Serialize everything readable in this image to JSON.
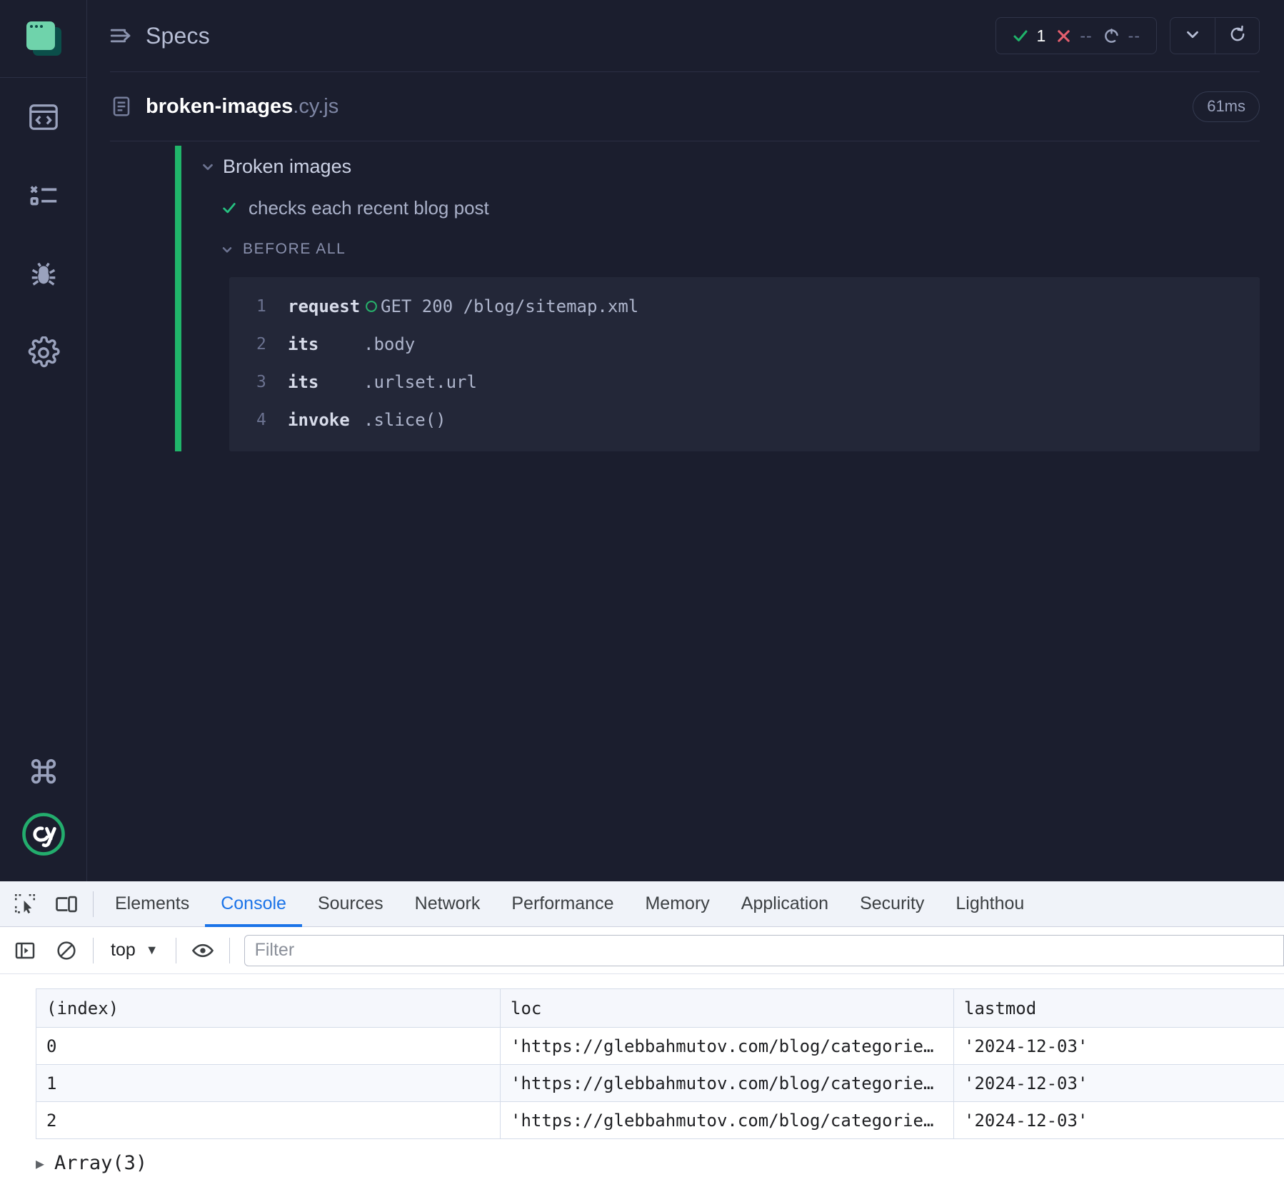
{
  "app": {
    "logo_icon": "cypress-specs-logo",
    "rail_items": [
      {
        "name": "specs",
        "icon": "browser-code-icon"
      },
      {
        "name": "runs",
        "icon": "test-results-list-icon"
      },
      {
        "name": "debug",
        "icon": "bug-icon"
      },
      {
        "name": "settings",
        "icon": "gear-icon"
      },
      {
        "name": "shortcuts",
        "icon": "command-key-icon"
      },
      {
        "name": "cypress-brand",
        "icon": "cy-logo-icon"
      }
    ]
  },
  "topbar": {
    "title": "Specs",
    "title_icon": "specs-list-icon",
    "stats": {
      "passed_icon": "check-icon",
      "passed": "1",
      "failed_icon": "x-icon",
      "failed": "--",
      "pending_icon": "circle-dashed-icon",
      "pending": "--"
    },
    "chevron_icon": "chevron-down-icon",
    "reload_icon": "refresh-icon"
  },
  "spec": {
    "file_icon": "file-document-icon",
    "name": "broken-images",
    "ext": ".cy.js",
    "duration": "61ms"
  },
  "tree": {
    "suite": {
      "chevron_icon": "chevron-down-icon",
      "title": "Broken images"
    },
    "test": {
      "status_icon": "check-icon",
      "title": "checks each recent blog post"
    },
    "hook": {
      "chevron_icon": "chevron-down-icon",
      "title": "BEFORE ALL"
    },
    "commands": [
      {
        "num": "1",
        "name": "request",
        "status_icon": "circle-outline-icon",
        "args": "GET 200 /blog/sitemap.xml"
      },
      {
        "num": "2",
        "name": "its",
        "args": ".body"
      },
      {
        "num": "3",
        "name": "its",
        "args": ".urlset.url"
      },
      {
        "num": "4",
        "name": "invoke",
        "args": ".slice()"
      }
    ]
  },
  "devtools": {
    "inspect_icon": "inspect-element-icon",
    "device_icon": "device-toolbar-icon",
    "tabs": [
      {
        "label": "Elements",
        "active": false
      },
      {
        "label": "Console",
        "active": true
      },
      {
        "label": "Sources",
        "active": false
      },
      {
        "label": "Network",
        "active": false
      },
      {
        "label": "Performance",
        "active": false
      },
      {
        "label": "Memory",
        "active": false
      },
      {
        "label": "Application",
        "active": false
      },
      {
        "label": "Security",
        "active": false
      },
      {
        "label": "Lighthou",
        "active": false
      }
    ],
    "toolbar": {
      "sidebar_icon": "console-sidebar-icon",
      "clear_icon": "clear-console-icon",
      "context": "top",
      "context_caret": "▼",
      "eye_icon": "eye-icon",
      "filter_placeholder": "Filter",
      "filter_value": ""
    },
    "console_table": {
      "headers": [
        "(index)",
        "loc",
        "lastmod"
      ],
      "rows": [
        {
          "index": "0",
          "loc": "'https://glebbahmutov.com/blog/categories/…",
          "lastmod": "'2024-12-03'"
        },
        {
          "index": "1",
          "loc": "'https://glebbahmutov.com/blog/categories/…",
          "lastmod": "'2024-12-03'"
        },
        {
          "index": "2",
          "loc": "'https://glebbahmutov.com/blog/categories/…",
          "lastmod": "'2024-12-03'"
        }
      ]
    },
    "array_summary": {
      "triangle_icon": "disclosure-triangle-icon",
      "label": "Array(3)"
    }
  }
}
